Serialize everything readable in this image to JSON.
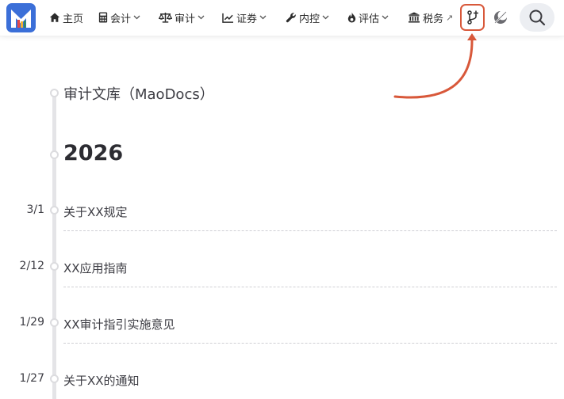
{
  "navbar": {
    "logo": "maodocs-logo",
    "items": [
      {
        "label": "主页",
        "icon": "home-icon",
        "dropdown": false
      },
      {
        "label": "会计",
        "icon": "calculator-icon",
        "dropdown": true
      },
      {
        "label": "审计",
        "icon": "scale-icon",
        "dropdown": true
      },
      {
        "label": "证券",
        "icon": "chart-line-icon",
        "dropdown": true
      },
      {
        "label": "内控",
        "icon": "wrench-icon",
        "dropdown": true
      },
      {
        "label": "评估",
        "icon": "fire-icon",
        "dropdown": true
      },
      {
        "label": "税务",
        "icon": "bank-icon",
        "dropdown": false,
        "external": true
      }
    ],
    "external_mark": "↗",
    "git_button": "git-branch-icon",
    "theme_toggle": "theme-icon",
    "search_button": "search-icon",
    "accent_color": "#d8583a"
  },
  "timeline": {
    "site_title": "审计文库（MaoDocs）",
    "year": "2026",
    "posts": [
      {
        "date": "3/1",
        "title": "关于XX规定"
      },
      {
        "date": "2/12",
        "title": "XX应用指南"
      },
      {
        "date": "1/29",
        "title": "XX审计指引实施意见"
      },
      {
        "date": "1/27",
        "title": "关于XX的通知"
      }
    ]
  }
}
